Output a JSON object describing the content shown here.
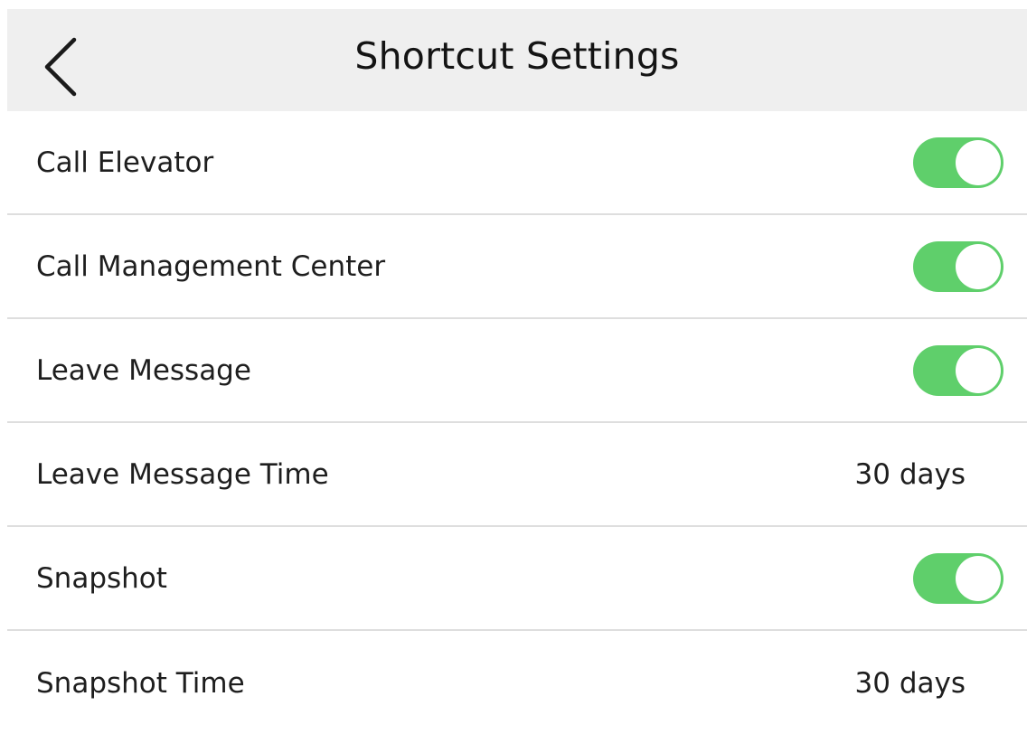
{
  "header": {
    "title": "Shortcut Settings",
    "back_icon": "chevron-left-icon"
  },
  "colors": {
    "header_bg": "#efefef",
    "toggle_on": "#5fcf6b",
    "divider": "#dedede"
  },
  "settings": [
    {
      "label": "Call Elevator",
      "type": "toggle",
      "on": true
    },
    {
      "label": "Call Management Center",
      "type": "toggle",
      "on": true
    },
    {
      "label": "Leave Message",
      "type": "toggle",
      "on": true
    },
    {
      "label": "Leave Message Time",
      "type": "value",
      "value": "30 days"
    },
    {
      "label": "Snapshot",
      "type": "toggle",
      "on": true
    },
    {
      "label": "Snapshot Time",
      "type": "value",
      "value": "30 days"
    }
  ]
}
